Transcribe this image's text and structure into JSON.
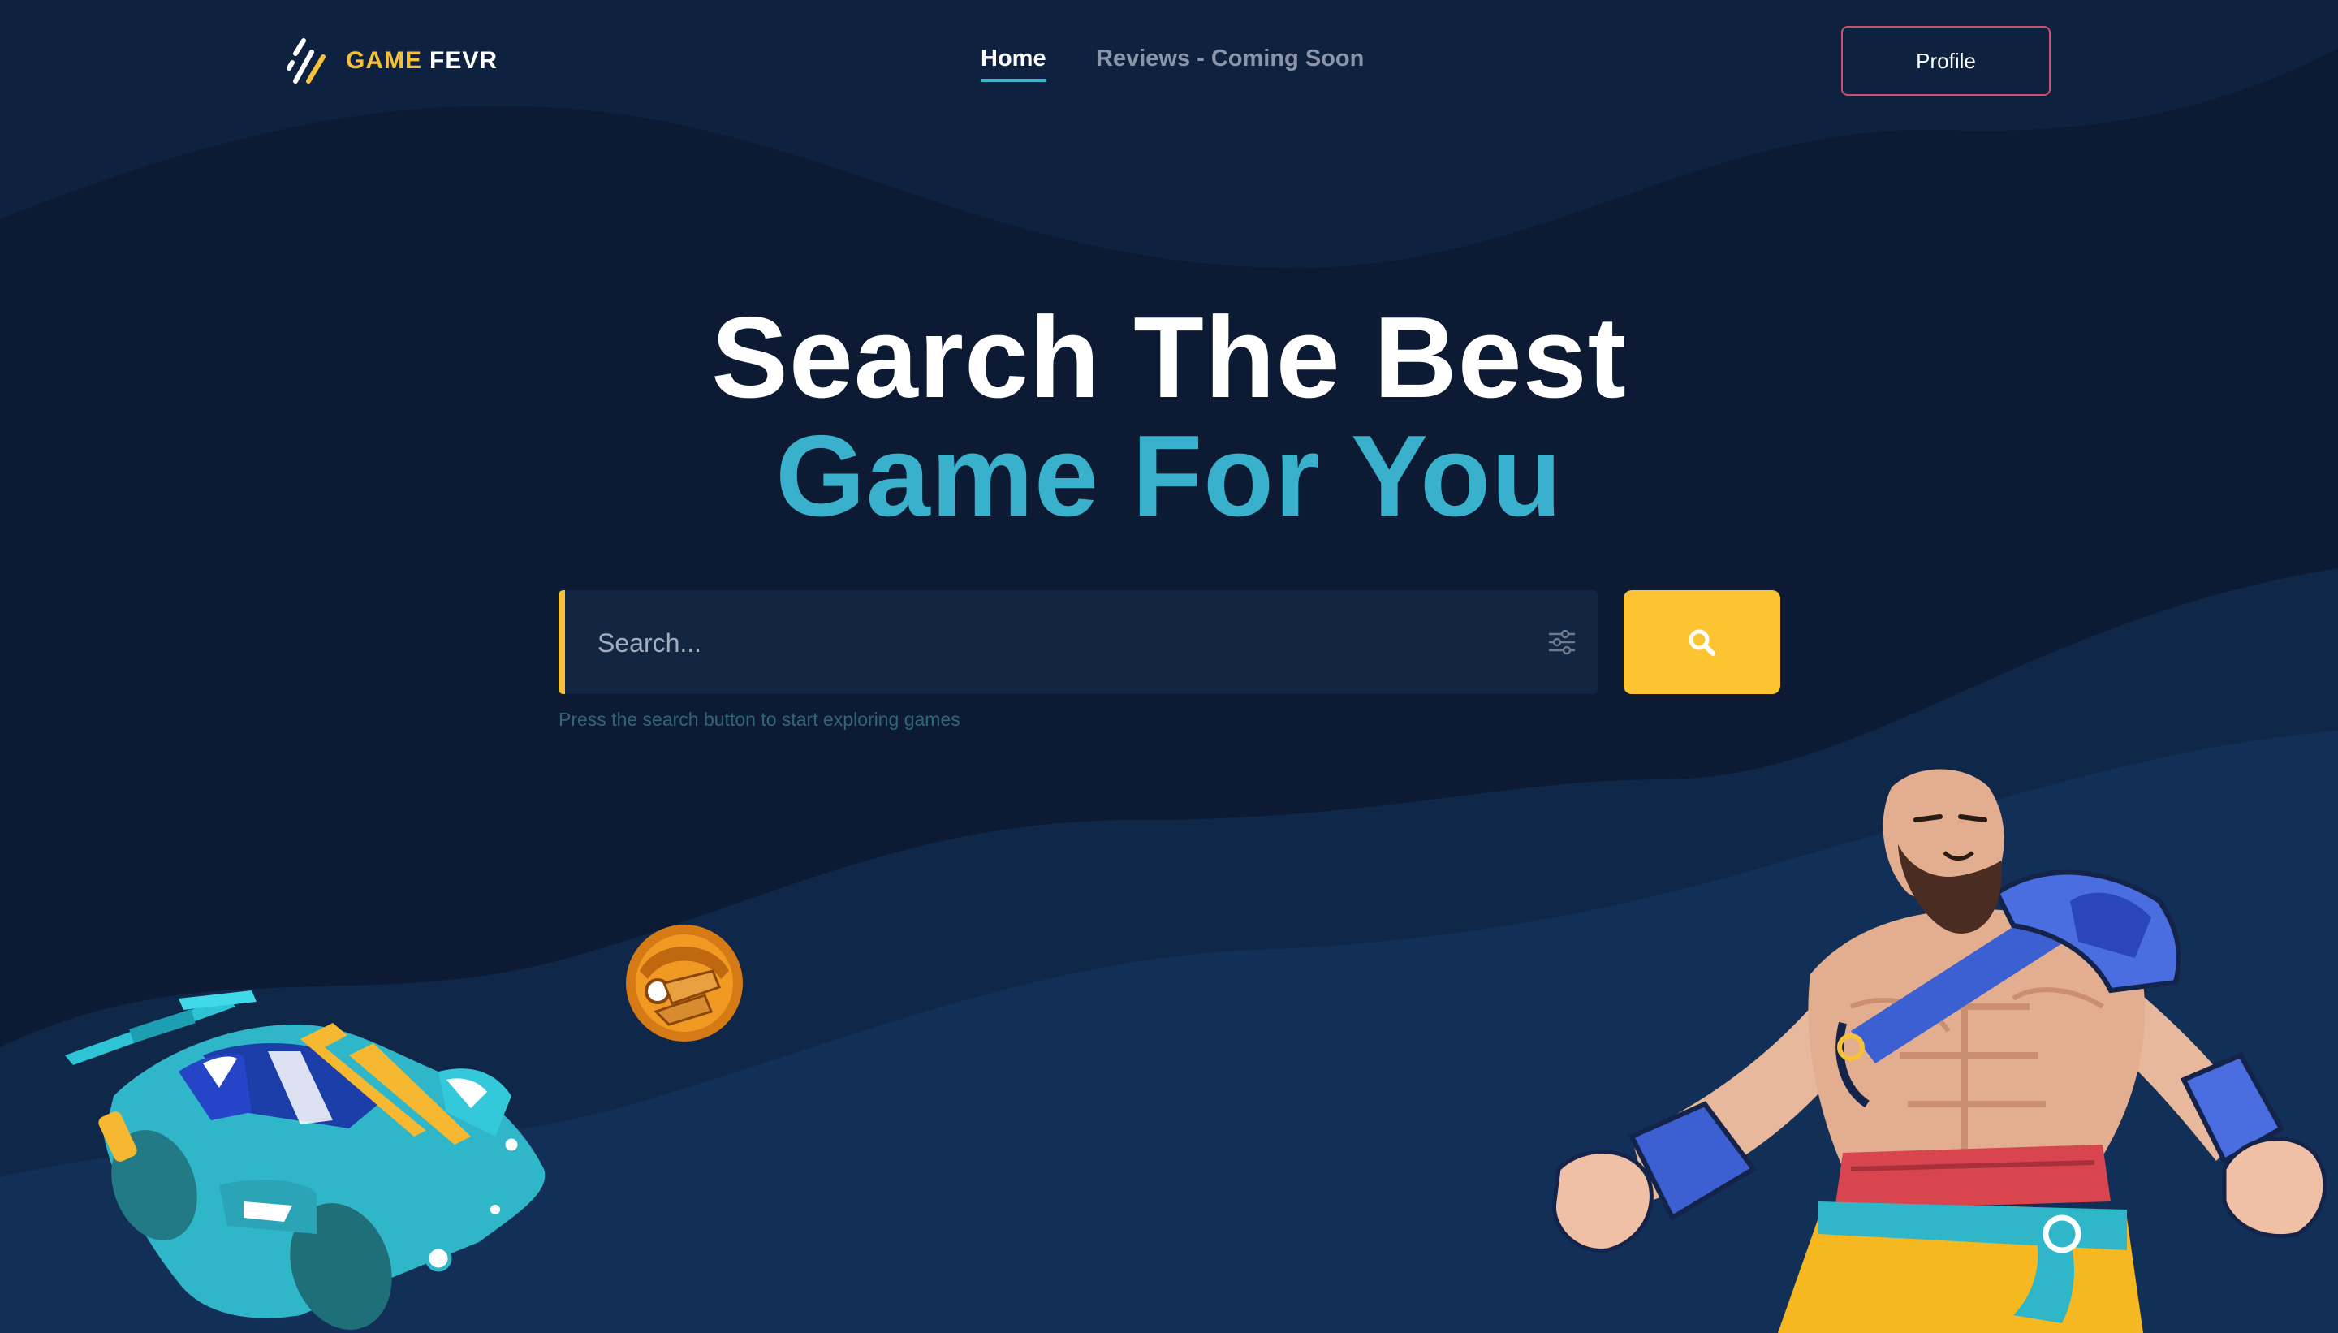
{
  "brand": {
    "word1": "GAME",
    "word2": "FEVR",
    "accent_color": "#f5c23a"
  },
  "nav": {
    "home": "Home",
    "reviews": "Reviews - Coming Soon",
    "profile": "Profile"
  },
  "hero": {
    "line1": "Search The Best",
    "line2": "Game For You",
    "line2_color": "#3ab1cc"
  },
  "search": {
    "placeholder": "Search...",
    "value": "",
    "hint": "Press the search button to start exploring games",
    "button_color": "#fdc431"
  },
  "icons": {
    "logo": "game-fevr-logo-icon",
    "filter": "sliders-filter-icon",
    "search": "magnifier-search-icon"
  },
  "colors": {
    "background": "#0c1b33",
    "wave_light": "#12305a",
    "wave_dark": "#0e2444"
  }
}
